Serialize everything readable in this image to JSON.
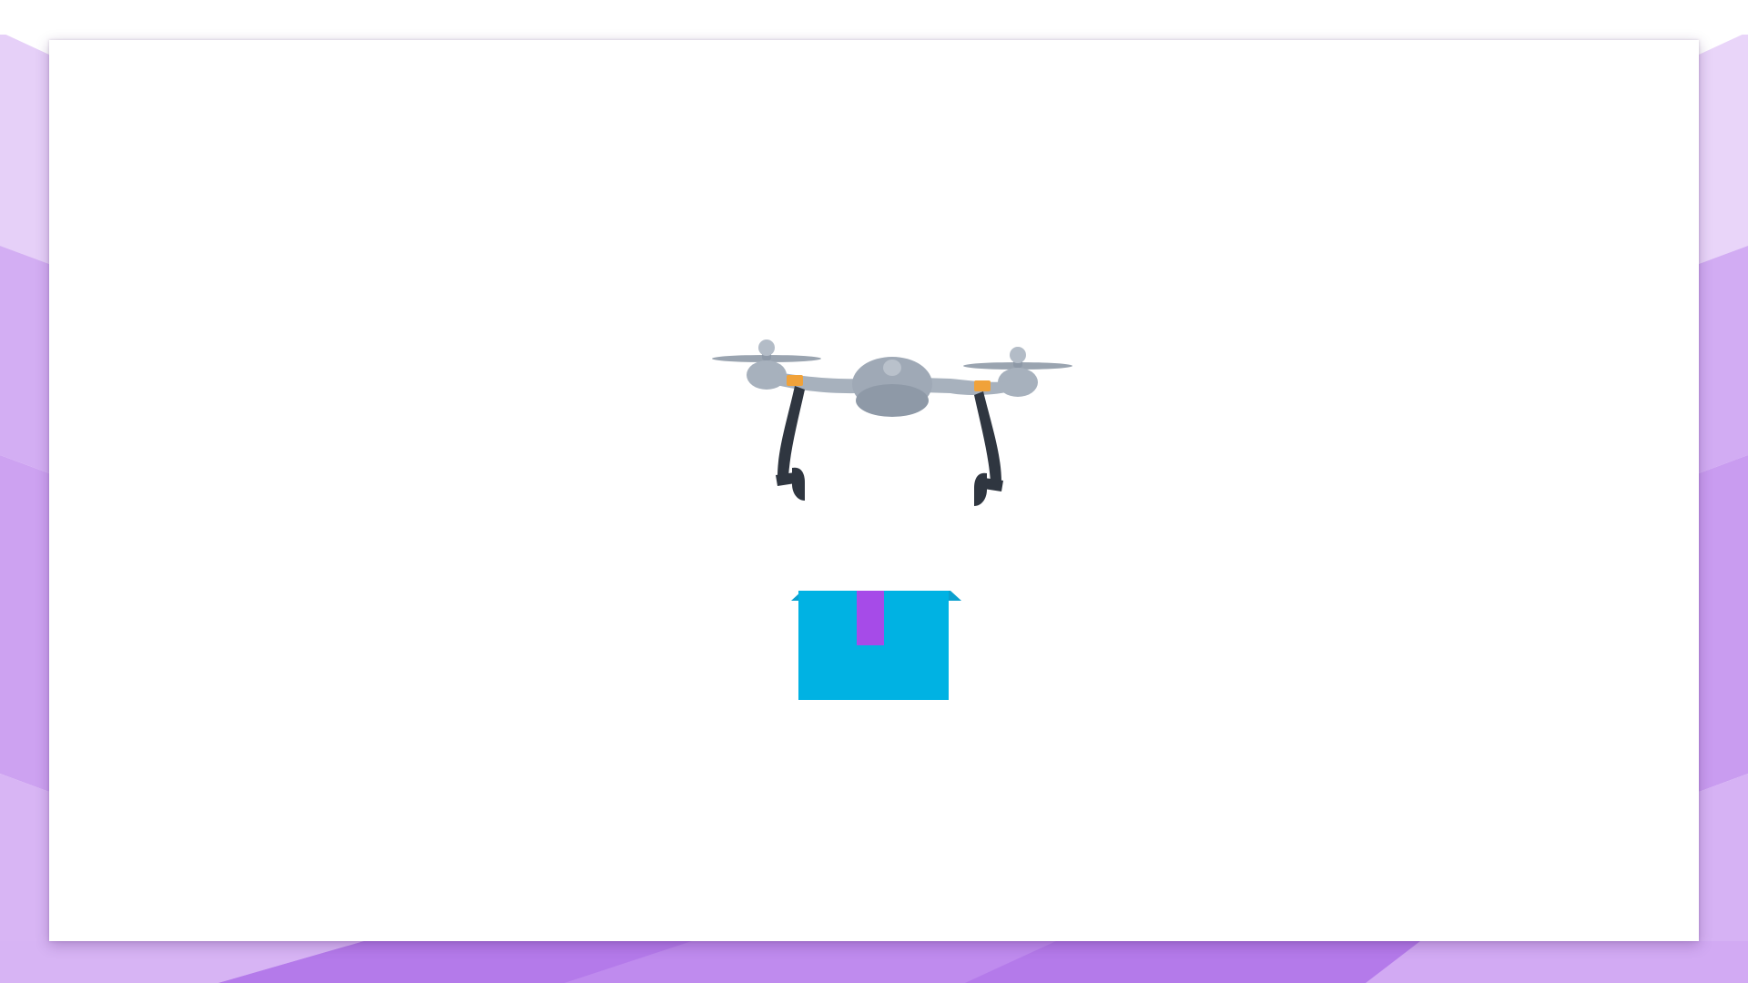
{
  "scene": {
    "subject": "drone-delivery",
    "icons": [
      "drone-icon",
      "package-box-icon"
    ]
  },
  "colors": {
    "frame_light": "#e4cdf7",
    "frame_mid": "#cfa6f2",
    "frame_dark": "#b57bec",
    "drone_body": "#a7b1bd",
    "drone_body_shade": "#8e99a7",
    "drone_legs": "#2f3640",
    "drone_joint": "#f0a23a",
    "box": "#00b2e3",
    "box_top": "#0aa0cf",
    "tape": "#a64be8"
  }
}
